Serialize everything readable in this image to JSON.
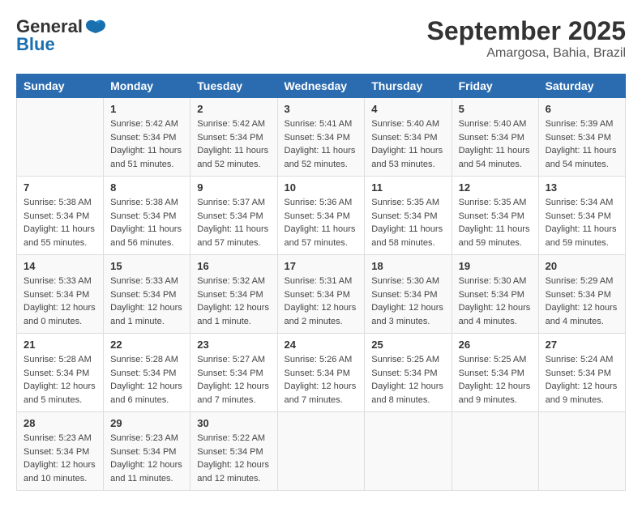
{
  "header": {
    "logo_line1": "General",
    "logo_line2": "Blue",
    "month_title": "September 2025",
    "location": "Amargosa, Bahia, Brazil"
  },
  "days_of_week": [
    "Sunday",
    "Monday",
    "Tuesday",
    "Wednesday",
    "Thursday",
    "Friday",
    "Saturday"
  ],
  "weeks": [
    [
      {
        "day": "",
        "info": ""
      },
      {
        "day": "1",
        "info": "Sunrise: 5:42 AM\nSunset: 5:34 PM\nDaylight: 11 hours\nand 51 minutes."
      },
      {
        "day": "2",
        "info": "Sunrise: 5:42 AM\nSunset: 5:34 PM\nDaylight: 11 hours\nand 52 minutes."
      },
      {
        "day": "3",
        "info": "Sunrise: 5:41 AM\nSunset: 5:34 PM\nDaylight: 11 hours\nand 52 minutes."
      },
      {
        "day": "4",
        "info": "Sunrise: 5:40 AM\nSunset: 5:34 PM\nDaylight: 11 hours\nand 53 minutes."
      },
      {
        "day": "5",
        "info": "Sunrise: 5:40 AM\nSunset: 5:34 PM\nDaylight: 11 hours\nand 54 minutes."
      },
      {
        "day": "6",
        "info": "Sunrise: 5:39 AM\nSunset: 5:34 PM\nDaylight: 11 hours\nand 54 minutes."
      }
    ],
    [
      {
        "day": "7",
        "info": "Sunrise: 5:38 AM\nSunset: 5:34 PM\nDaylight: 11 hours\nand 55 minutes."
      },
      {
        "day": "8",
        "info": "Sunrise: 5:38 AM\nSunset: 5:34 PM\nDaylight: 11 hours\nand 56 minutes."
      },
      {
        "day": "9",
        "info": "Sunrise: 5:37 AM\nSunset: 5:34 PM\nDaylight: 11 hours\nand 57 minutes."
      },
      {
        "day": "10",
        "info": "Sunrise: 5:36 AM\nSunset: 5:34 PM\nDaylight: 11 hours\nand 57 minutes."
      },
      {
        "day": "11",
        "info": "Sunrise: 5:35 AM\nSunset: 5:34 PM\nDaylight: 11 hours\nand 58 minutes."
      },
      {
        "day": "12",
        "info": "Sunrise: 5:35 AM\nSunset: 5:34 PM\nDaylight: 11 hours\nand 59 minutes."
      },
      {
        "day": "13",
        "info": "Sunrise: 5:34 AM\nSunset: 5:34 PM\nDaylight: 11 hours\nand 59 minutes."
      }
    ],
    [
      {
        "day": "14",
        "info": "Sunrise: 5:33 AM\nSunset: 5:34 PM\nDaylight: 12 hours\nand 0 minutes."
      },
      {
        "day": "15",
        "info": "Sunrise: 5:33 AM\nSunset: 5:34 PM\nDaylight: 12 hours\nand 1 minute."
      },
      {
        "day": "16",
        "info": "Sunrise: 5:32 AM\nSunset: 5:34 PM\nDaylight: 12 hours\nand 1 minute."
      },
      {
        "day": "17",
        "info": "Sunrise: 5:31 AM\nSunset: 5:34 PM\nDaylight: 12 hours\nand 2 minutes."
      },
      {
        "day": "18",
        "info": "Sunrise: 5:30 AM\nSunset: 5:34 PM\nDaylight: 12 hours\nand 3 minutes."
      },
      {
        "day": "19",
        "info": "Sunrise: 5:30 AM\nSunset: 5:34 PM\nDaylight: 12 hours\nand 4 minutes."
      },
      {
        "day": "20",
        "info": "Sunrise: 5:29 AM\nSunset: 5:34 PM\nDaylight: 12 hours\nand 4 minutes."
      }
    ],
    [
      {
        "day": "21",
        "info": "Sunrise: 5:28 AM\nSunset: 5:34 PM\nDaylight: 12 hours\nand 5 minutes."
      },
      {
        "day": "22",
        "info": "Sunrise: 5:28 AM\nSunset: 5:34 PM\nDaylight: 12 hours\nand 6 minutes."
      },
      {
        "day": "23",
        "info": "Sunrise: 5:27 AM\nSunset: 5:34 PM\nDaylight: 12 hours\nand 7 minutes."
      },
      {
        "day": "24",
        "info": "Sunrise: 5:26 AM\nSunset: 5:34 PM\nDaylight: 12 hours\nand 7 minutes."
      },
      {
        "day": "25",
        "info": "Sunrise: 5:25 AM\nSunset: 5:34 PM\nDaylight: 12 hours\nand 8 minutes."
      },
      {
        "day": "26",
        "info": "Sunrise: 5:25 AM\nSunset: 5:34 PM\nDaylight: 12 hours\nand 9 minutes."
      },
      {
        "day": "27",
        "info": "Sunrise: 5:24 AM\nSunset: 5:34 PM\nDaylight: 12 hours\nand 9 minutes."
      }
    ],
    [
      {
        "day": "28",
        "info": "Sunrise: 5:23 AM\nSunset: 5:34 PM\nDaylight: 12 hours\nand 10 minutes."
      },
      {
        "day": "29",
        "info": "Sunrise: 5:23 AM\nSunset: 5:34 PM\nDaylight: 12 hours\nand 11 minutes."
      },
      {
        "day": "30",
        "info": "Sunrise: 5:22 AM\nSunset: 5:34 PM\nDaylight: 12 hours\nand 12 minutes."
      },
      {
        "day": "",
        "info": ""
      },
      {
        "day": "",
        "info": ""
      },
      {
        "day": "",
        "info": ""
      },
      {
        "day": "",
        "info": ""
      }
    ]
  ]
}
